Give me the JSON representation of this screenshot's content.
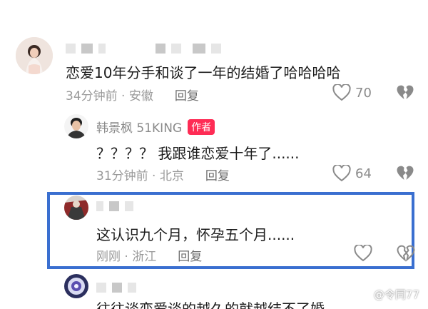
{
  "comments": [
    {
      "text": "恋爱10年分手和谈了一年的结婚了哈哈哈哈",
      "time_location": "34分钟前 · 安徽",
      "reply_label": "回复",
      "likes": "70"
    },
    {
      "username": "韩景枫 51KING",
      "author_badge": "作者",
      "text": "？？？？ 我跟谁恋爱十年了......",
      "time_location": "31分钟前 · 北京",
      "reply_label": "回复",
      "likes": "64"
    },
    {
      "text": "这认识九个月，怀孕五个月......",
      "time_location": "刚刚 · 浙江",
      "reply_label": "回复"
    },
    {
      "text": "往往谈恋爱谈的越久的就越结不了婚"
    }
  ],
  "watermark": "@令同77",
  "colors": {
    "highlight_border": "#3a6fd0",
    "author_badge_bg": "#fe2c55",
    "meta_text": "#9a9a9a"
  },
  "icons": {
    "like": "heart-outline-icon",
    "dislike": "broken-heart-icon"
  }
}
